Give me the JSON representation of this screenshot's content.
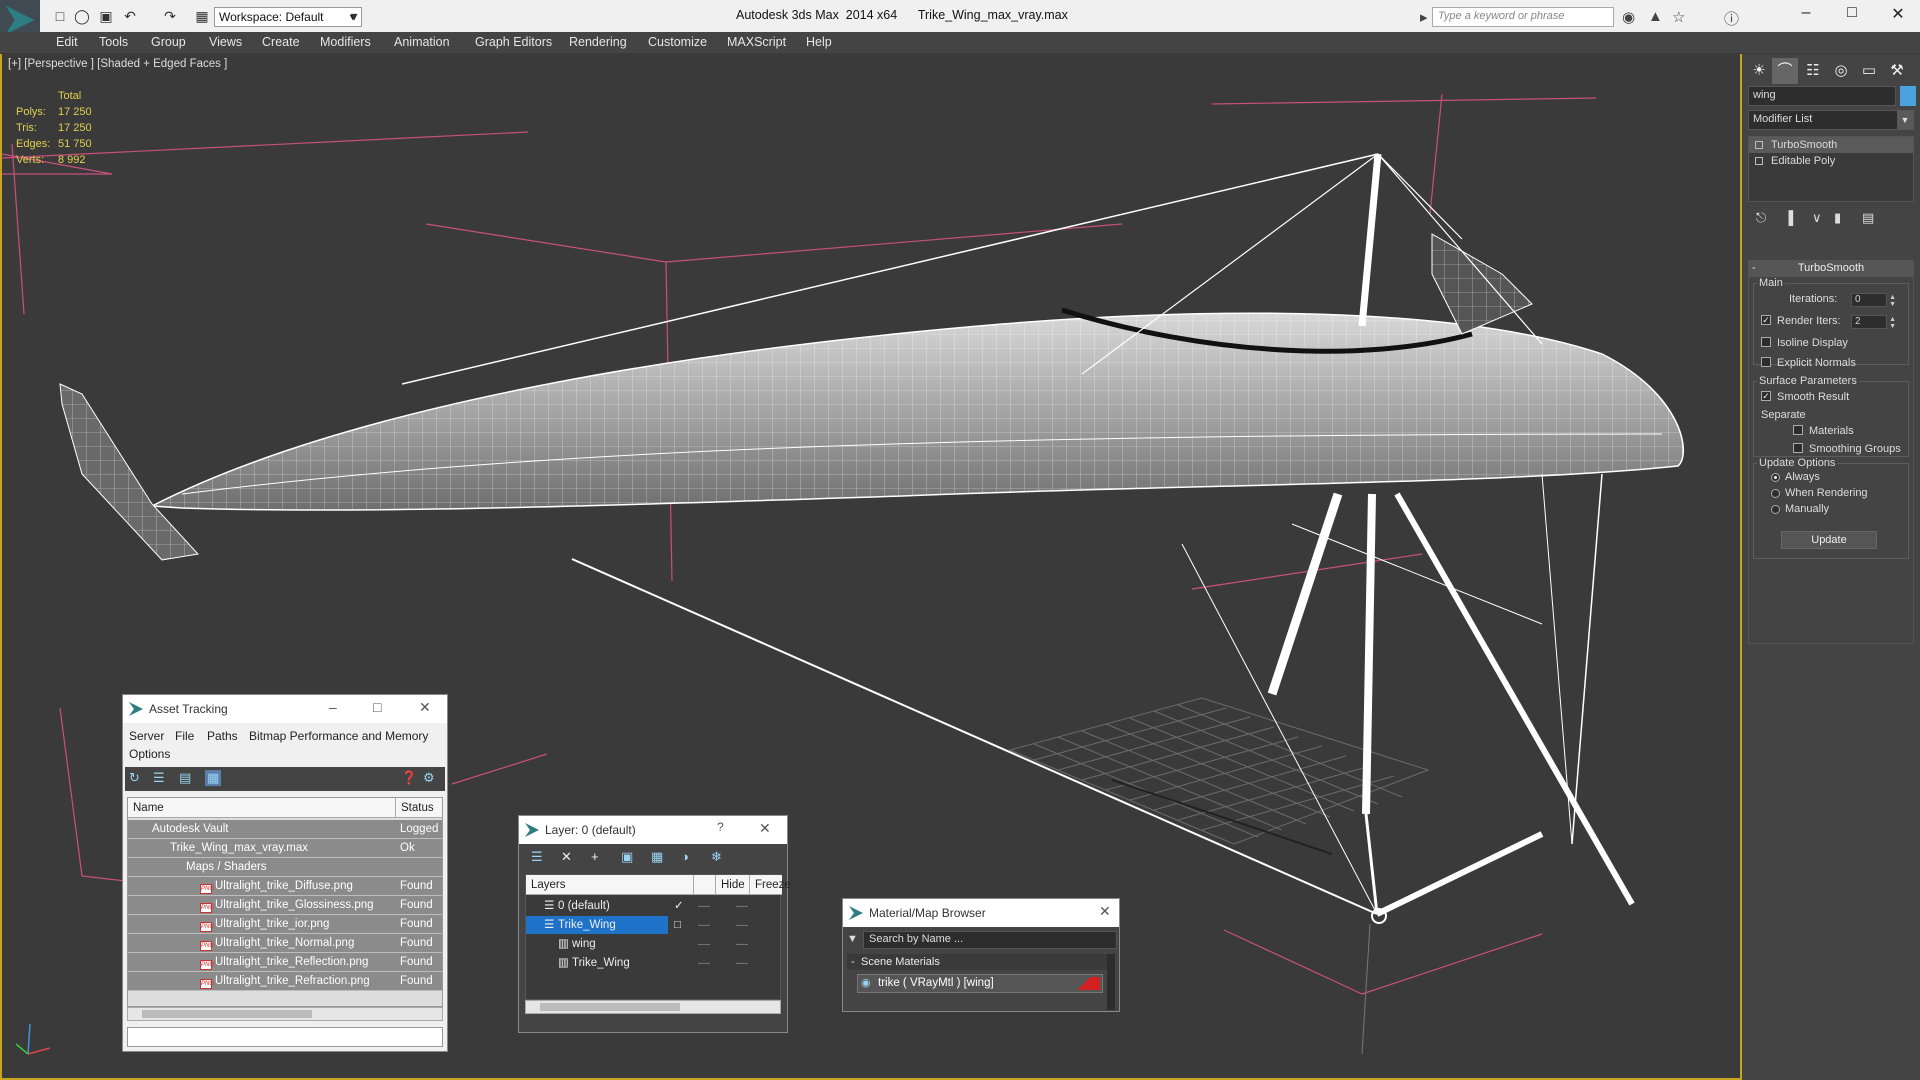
{
  "window": {
    "app_title": "Autodesk 3ds Max  2014 x64",
    "file_title": "Trike_Wing_max_vray.max",
    "workspace": "Workspace: Default",
    "search_placeholder": "Type a keyword or phrase"
  },
  "menu": [
    "Edit",
    "Tools",
    "Group",
    "Views",
    "Create",
    "Modifiers",
    "Animation",
    "Graph Editors",
    "Rendering",
    "Customize",
    "MAXScript",
    "Help"
  ],
  "viewport": {
    "label": "[+] [Perspective ] [Shaded + Edged Faces ]",
    "stats": {
      "header": "Total",
      "polys_label": "Polys:",
      "polys": "17 250",
      "tris_label": "Tris:",
      "tris": "17 250",
      "edges_label": "Edges:",
      "edges": "51 750",
      "verts_label": "Verts:",
      "verts": "8 992"
    }
  },
  "command_panel": {
    "object_name": "wing",
    "modifier_list": "Modifier List",
    "stack": [
      "TurboSmooth",
      "Editable Poly"
    ],
    "rollout_title": "TurboSmooth",
    "main_label": "Main",
    "iterations_label": "Iterations:",
    "iterations": "0",
    "render_iters_label": "Render Iters:",
    "render_iters": "2",
    "isoline": "Isoline Display",
    "explicit_normals": "Explicit Normals",
    "surface_params": "Surface Parameters",
    "smooth_result": "Smooth Result",
    "separate": "Separate",
    "materials": "Materials",
    "smoothing_groups": "Smoothing Groups",
    "update_options": "Update Options",
    "always": "Always",
    "when_rendering": "When Rendering",
    "manually": "Manually",
    "update_button": "Update"
  },
  "asset_tracking": {
    "title": "Asset Tracking",
    "menu": [
      "Server",
      "File",
      "Paths",
      "Bitmap Performance and Memory",
      "Options"
    ],
    "col_name": "Name",
    "col_status": "Status",
    "rows": [
      {
        "name": "Autodesk Vault",
        "status": "Logged"
      },
      {
        "name": "Trike_Wing_max_vray.max",
        "status": "Ok"
      },
      {
        "name": "Maps / Shaders",
        "status": ""
      },
      {
        "name": "Ultralight_trike_Diffuse.png",
        "status": "Found"
      },
      {
        "name": "Ultralight_trike_Glossiness.png",
        "status": "Found"
      },
      {
        "name": "Ultralight_trike_ior.png",
        "status": "Found"
      },
      {
        "name": "Ultralight_trike_Normal.png",
        "status": "Found"
      },
      {
        "name": "Ultralight_trike_Reflection.png",
        "status": "Found"
      },
      {
        "name": "Ultralight_trike_Refraction.png",
        "status": "Found"
      }
    ]
  },
  "layer_window": {
    "title": "Layer: 0 (default)",
    "help": "?",
    "col_layers": "Layers",
    "col_hide": "Hide",
    "col_freeze": "Freeze",
    "rows": [
      "0 (default)",
      "Trike_Wing",
      "wing",
      "Trike_Wing"
    ]
  },
  "material_browser": {
    "title": "Material/Map Browser",
    "search": "Search by Name ...",
    "group": "Scene Materials",
    "item": "trike  ( VRayMtl )  [wing]"
  },
  "colors": {
    "accent_viewport_border": "#c8a51e",
    "stats_text": "#e3d050",
    "selection": "#1e73c9"
  }
}
